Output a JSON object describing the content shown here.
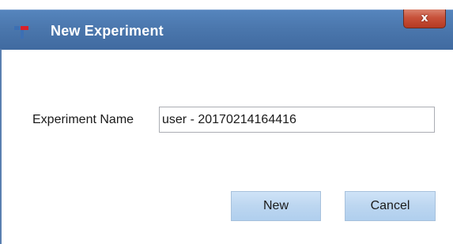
{
  "window": {
    "title": "New Experiment",
    "close_glyph": "x",
    "app_icon": "experiment-app-icon",
    "colors": {
      "titlebar": "#4b77ad",
      "close_button": "#c8513a",
      "button": "#bcd6f0",
      "icon_red": "#d9202a",
      "icon_blue": "#3c6fb4"
    }
  },
  "form": {
    "experiment_name_label": "Experiment Name",
    "experiment_name_value": "user - 20170214164416"
  },
  "buttons": {
    "new_label": "New",
    "cancel_label": "Cancel"
  }
}
